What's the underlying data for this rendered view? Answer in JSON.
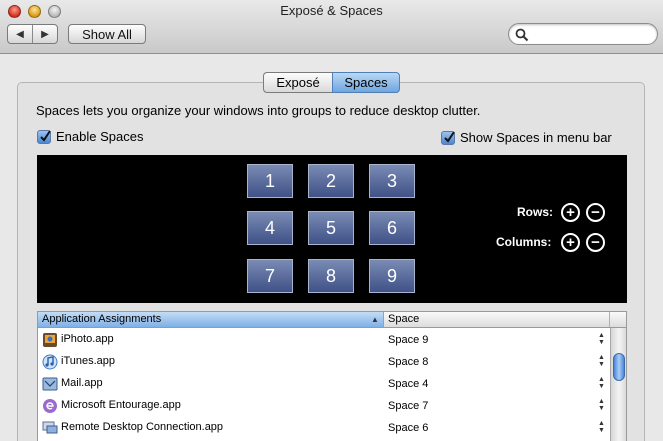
{
  "window": {
    "title": "Exposé & Spaces"
  },
  "toolbar": {
    "back_glyph": "◀",
    "forward_glyph": "▶",
    "show_all_label": "Show All",
    "search_placeholder": "",
    "search_value": ""
  },
  "tabs": [
    {
      "label": "Exposé",
      "active": false
    },
    {
      "label": "Spaces",
      "active": true
    }
  ],
  "description": "Spaces lets you organize your windows into groups to reduce desktop clutter.",
  "checkboxes": {
    "enable_spaces": {
      "label": "Enable Spaces",
      "checked": true
    },
    "show_menu_bar": {
      "label": "Show Spaces in menu bar",
      "checked": true
    }
  },
  "spaces_grid": {
    "tiles": [
      "1",
      "2",
      "3",
      "4",
      "5",
      "6",
      "7",
      "8",
      "9"
    ],
    "rows_label": "Rows:",
    "columns_label": "Columns:",
    "plus_glyph": "+",
    "minus_glyph": "−"
  },
  "table": {
    "columns": [
      "Application Assignments",
      "Space"
    ],
    "sort_glyph": "▲",
    "rows": [
      {
        "app": "iPhoto.app",
        "space": "Space 9",
        "icon": "iphoto-icon"
      },
      {
        "app": "iTunes.app",
        "space": "Space 8",
        "icon": "itunes-icon"
      },
      {
        "app": "Mail.app",
        "space": "Space 4",
        "icon": "mail-icon"
      },
      {
        "app": "Microsoft Entourage.app",
        "space": "Space 7",
        "icon": "entourage-icon"
      },
      {
        "app": "Remote Desktop Connection.app",
        "space": "Space 6",
        "icon": "remote-desktop-icon"
      }
    ]
  },
  "colors": {
    "accent": "#6fa6e0",
    "tile_fill": "#5a6ba0",
    "preview_background": "#000000"
  }
}
